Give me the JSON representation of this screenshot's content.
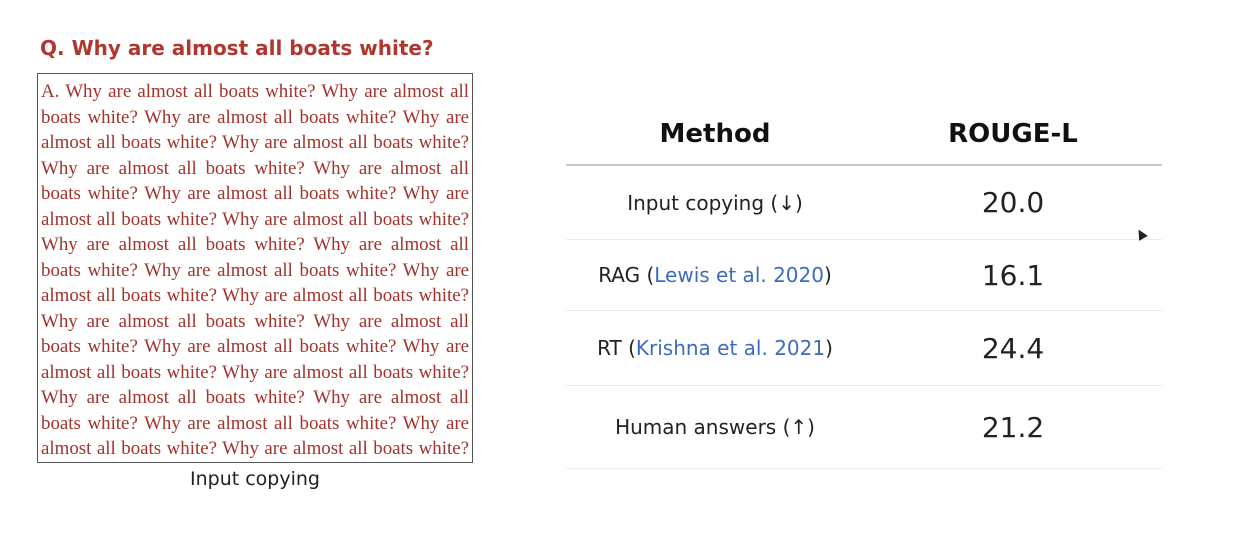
{
  "question": "Q. Why are almost all boats white?",
  "answer": "A. Why are almost all boats white? Why are almost all boats white? Why are almost all boats white? Why are almost all boats white? Why are almost all boats white? Why are almost all boats white? Why are almost all boats white? Why are almost all boats white? Why are almost all boats white? Why are almost all boats white? Why are almost all boats white? Why are almost all boats white? Why are almost all boats white? Why are almost all boats white? Why are almost all boats white? Why are almost all boats white? Why are almost all boats white? Why are almost all boats white? Why are almost all boats white? Why are almost all boats white? Why are almost all boats white? Why are almost all boats white? Why are almost all boats white? Why are almost all boats white? Why are almost all boats white? Why are almost all boats white? Why are almost all boats white?",
  "caption": "Input copying",
  "table": {
    "headers": [
      "Method",
      "ROUGE-L"
    ],
    "rows": [
      {
        "method": "Input copying (↓)",
        "cite": "",
        "suffix": "",
        "score": "20.0"
      },
      {
        "method": "RAG (",
        "cite": "Lewis et al. 2020",
        "suffix": ")",
        "score": "16.1"
      },
      {
        "method": "RT (",
        "cite": "Krishna et al. 2021",
        "suffix": ")",
        "score": "24.4"
      },
      {
        "method": "Human answers (↑)",
        "cite": "",
        "suffix": "",
        "score": "21.2"
      }
    ]
  },
  "colors": {
    "question_text": "#b0362f",
    "answer_text": "#a3322b",
    "citation_link": "#3d6bbf"
  },
  "icons": {
    "cursor": "mouse-pointer-icon"
  }
}
